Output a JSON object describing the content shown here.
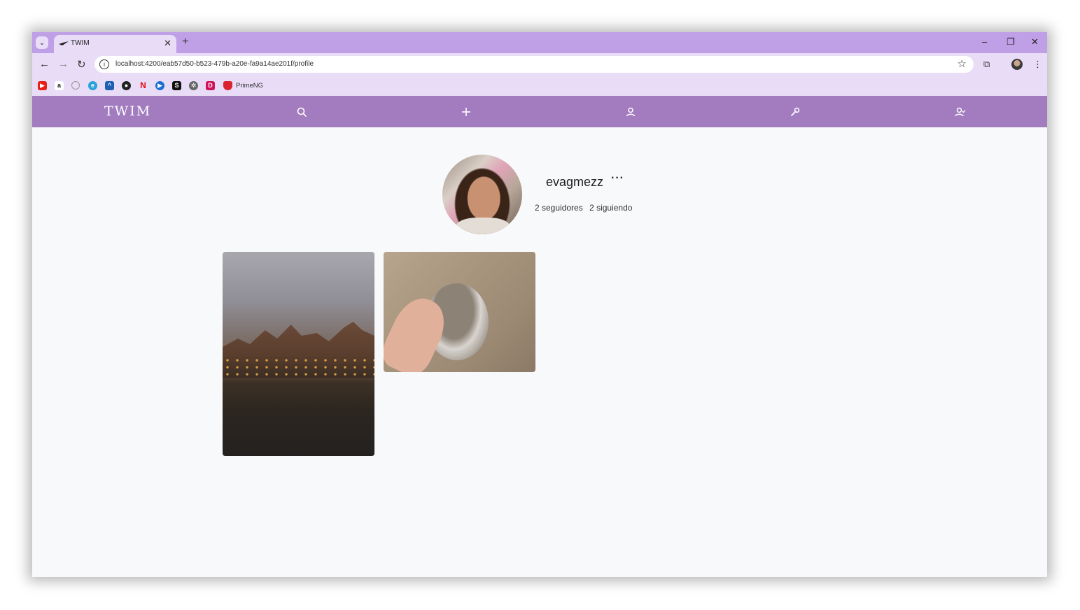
{
  "browser": {
    "tab_title": "TWIM",
    "tab_close": "✕",
    "new_tab": "+",
    "url": "localhost:4200/eab57d50-b523-479b-a20e-fa9a14ae201f/profile",
    "window_controls": {
      "minimize": "–",
      "restore": "❐",
      "close": "✕"
    },
    "bookmarks": {
      "icons": [
        "youtube-icon",
        "amazon-icon",
        "github-icon",
        "edge-icon",
        "graduation-cap-icon",
        "globe-icon",
        "netflix-icon",
        "play-icon",
        "s-icon",
        "openai-icon",
        "d-icon",
        "shield-icon"
      ],
      "primeng_label": "PrimeNG"
    }
  },
  "app": {
    "brand": "TWIM",
    "nav_icons": [
      "search-icon",
      "plus-icon",
      "user-icon",
      "wrench-icon",
      "user-check-icon"
    ]
  },
  "profile": {
    "username": "evagmezz",
    "more": "···",
    "followers": "2 seguidores",
    "following": "2 siguiendo"
  },
  "posts": [
    {
      "subject": "canal-city-photo"
    },
    {
      "subject": "cat-photo"
    }
  ]
}
